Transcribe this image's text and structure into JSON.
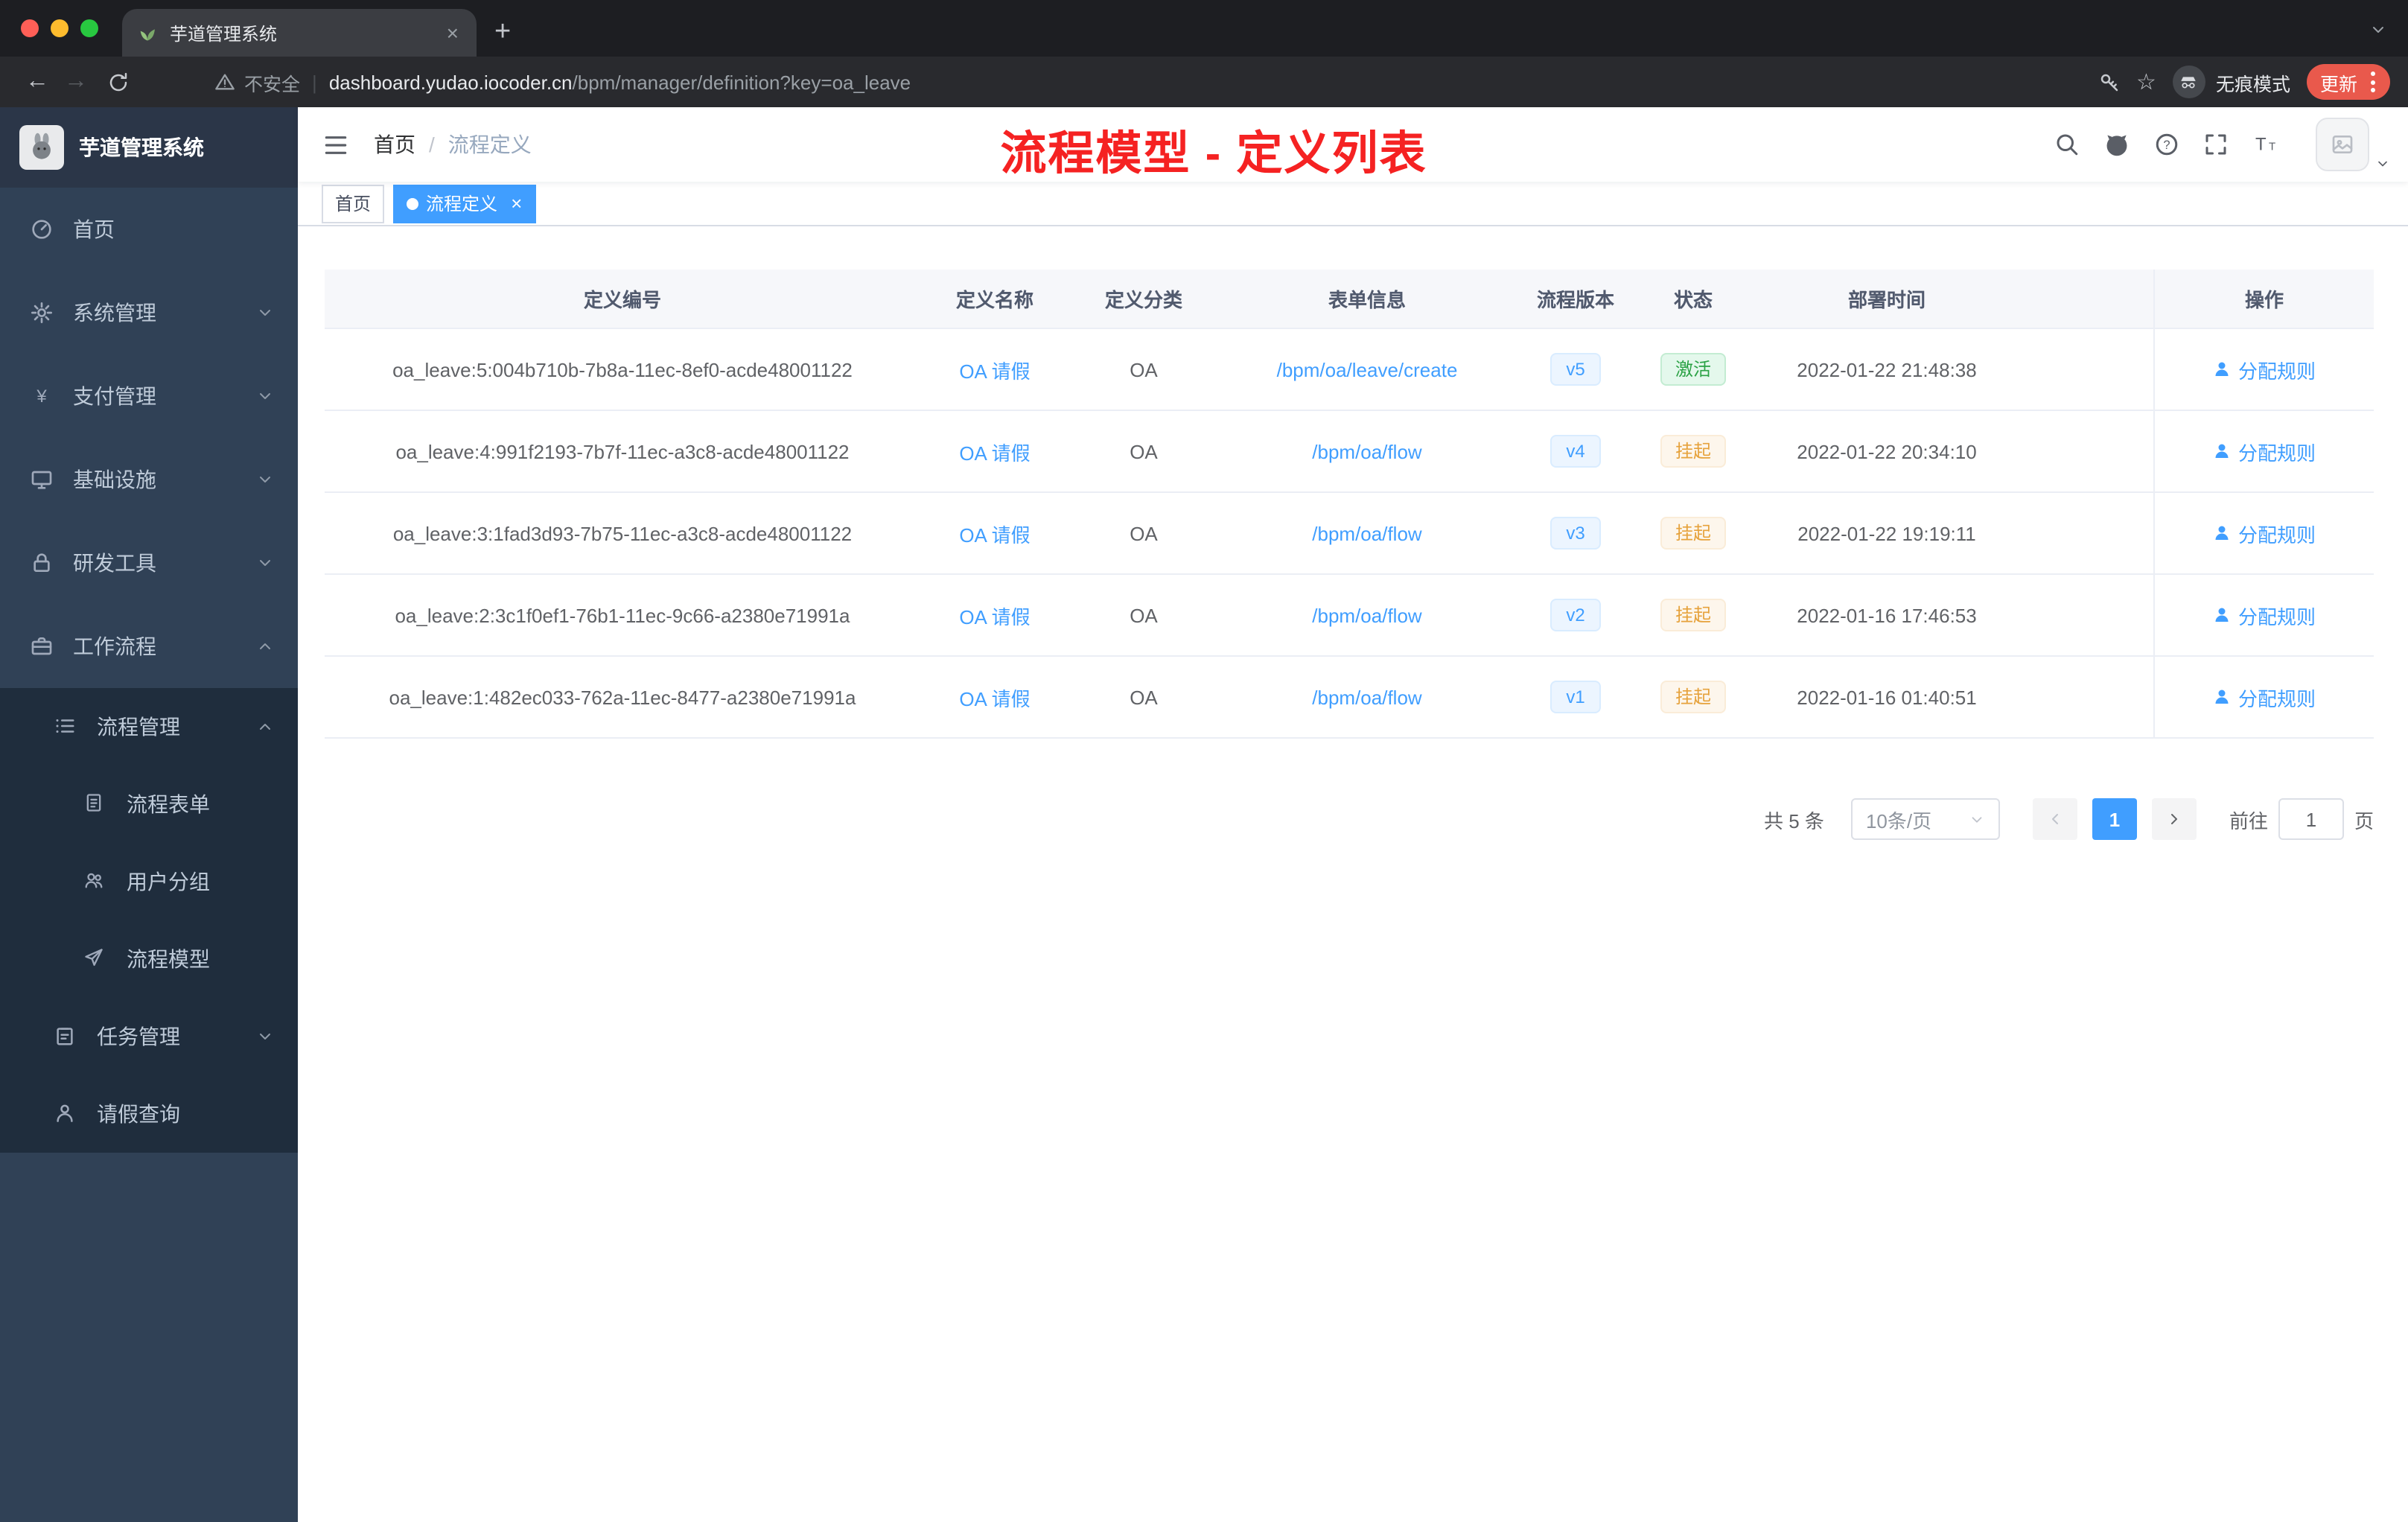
{
  "colors": {
    "accent": "#409eff",
    "success_text": "#2ba245",
    "warning_text": "#e6a23c",
    "annotation_red": "#f52222",
    "sidebar_bg": "#304156",
    "submenu_bg": "#1f2d3d",
    "update_pill": "#e9594c"
  },
  "browser": {
    "tab": {
      "title": "芋道管理系统"
    },
    "address": {
      "security_label": "不安全",
      "host": "dashboard.yudao.iocoder.cn",
      "path": "/bpm/manager/definition?key=oa_leave"
    },
    "incognito_label": "无痕模式",
    "update_label": "更新"
  },
  "sidebar": {
    "logo_title": "芋道管理系统",
    "items": [
      {
        "label": "首页",
        "icon": "dashboard-icon"
      },
      {
        "label": "系统管理",
        "icon": "gear-icon",
        "chevron": "down"
      },
      {
        "label": "支付管理",
        "icon": "yen-icon",
        "chevron": "down"
      },
      {
        "label": "基础设施",
        "icon": "monitor-icon",
        "chevron": "down"
      },
      {
        "label": "研发工具",
        "icon": "lock-icon",
        "chevron": "down"
      },
      {
        "label": "工作流程",
        "icon": "briefcase-icon",
        "chevron": "up"
      },
      {
        "label": "流程管理",
        "icon": "list-icon",
        "chevron": "up"
      },
      {
        "label": "流程表单",
        "icon": "document-icon"
      },
      {
        "label": "用户分组",
        "icon": "users-icon"
      },
      {
        "label": "流程模型",
        "icon": "send-icon"
      },
      {
        "label": "任务管理",
        "icon": "clipboard-icon",
        "chevron": "down"
      },
      {
        "label": "请假查询",
        "icon": "user-icon"
      }
    ]
  },
  "header": {
    "breadcrumb_home": "首页",
    "breadcrumb_separator": "/",
    "breadcrumb_current": "流程定义",
    "annotation": "流程模型 - 定义列表"
  },
  "tags": {
    "home": "首页",
    "active": "流程定义"
  },
  "table": {
    "columns": [
      "定义编号",
      "定义名称",
      "定义分类",
      "表单信息",
      "流程版本",
      "状态",
      "部署时间",
      "操作"
    ],
    "rows": [
      {
        "id": "oa_leave:5:004b710b-7b8a-11ec-8ef0-acde48001122",
        "name": "OA 请假",
        "category": "OA",
        "form": "/bpm/oa/leave/create",
        "version": "v5",
        "status": "激活",
        "time": "2022-01-22 21:48:38",
        "action": "分配规则"
      },
      {
        "id": "oa_leave:4:991f2193-7b7f-11ec-a3c8-acde48001122",
        "name": "OA 请假",
        "category": "OA",
        "form": "/bpm/oa/flow",
        "version": "v4",
        "status": "挂起",
        "time": "2022-01-22 20:34:10",
        "action": "分配规则"
      },
      {
        "id": "oa_leave:3:1fad3d93-7b75-11ec-a3c8-acde48001122",
        "name": "OA 请假",
        "category": "OA",
        "form": "/bpm/oa/flow",
        "version": "v3",
        "status": "挂起",
        "time": "2022-01-22 19:19:11",
        "action": "分配规则"
      },
      {
        "id": "oa_leave:2:3c1f0ef1-76b1-11ec-9c66-a2380e71991a",
        "name": "OA 请假",
        "category": "OA",
        "form": "/bpm/oa/flow",
        "version": "v2",
        "status": "挂起",
        "time": "2022-01-16 17:46:53",
        "action": "分配规则"
      },
      {
        "id": "oa_leave:1:482ec033-762a-11ec-8477-a2380e71991a",
        "name": "OA 请假",
        "category": "OA",
        "form": "/bpm/oa/flow",
        "version": "v1",
        "status": "挂起",
        "time": "2022-01-16 01:40:51",
        "action": "分配规则"
      }
    ]
  },
  "pagination": {
    "total": "共 5 条",
    "page_size": "10条/页",
    "current": "1",
    "goto_label": "前往",
    "goto_value": "1",
    "unit": "页"
  }
}
